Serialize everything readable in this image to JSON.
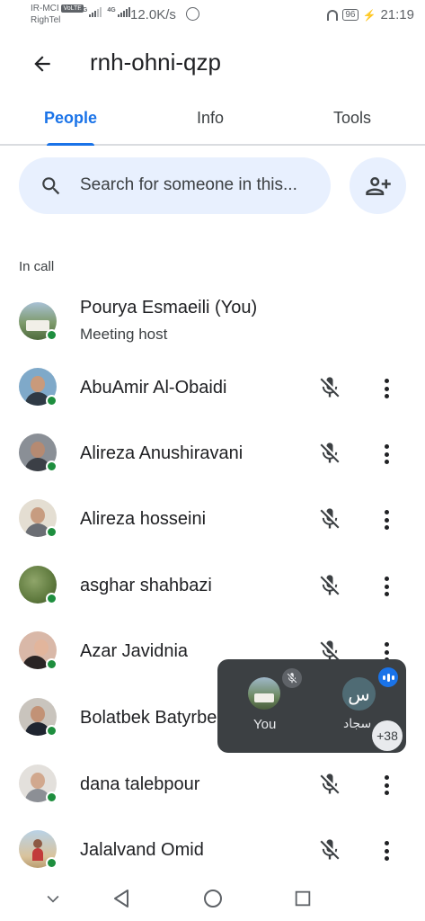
{
  "status_bar": {
    "carrier_1": "IR-MCI",
    "volte": "VoLTE",
    "carrier_2": "RighTel",
    "network_1": "4G",
    "network_2": "4G",
    "speed": "12.0K/s",
    "battery": "96",
    "time": "21:19"
  },
  "header": {
    "title": "rnh-ohni-qzp",
    "back_icon": "arrow-back-icon"
  },
  "tabs": [
    {
      "label": "People",
      "active": true
    },
    {
      "label": "Info",
      "active": false
    },
    {
      "label": "Tools",
      "active": false
    }
  ],
  "search": {
    "placeholder": "Search for someone in this...",
    "icon": "search-icon",
    "add_icon": "person-add-icon"
  },
  "section_label": "In call",
  "participants": [
    {
      "name": "Pourya Esmaeili (You)",
      "subtitle": "Meeting host",
      "muted": false,
      "online": true
    },
    {
      "name": "AbuAmir Al-Obaidi",
      "muted": true,
      "online": true
    },
    {
      "name": "Alireza Anushiravani",
      "muted": true,
      "online": true
    },
    {
      "name": "Alireza hosseini",
      "muted": true,
      "online": true
    },
    {
      "name": "asghar shahbazi",
      "muted": true,
      "online": true
    },
    {
      "name": "Azar Javidnia",
      "muted": true,
      "online": true
    },
    {
      "name": "Bolatbek Batyrbekov",
      "muted": true,
      "online": true
    },
    {
      "name": "dana talebpour",
      "muted": true,
      "online": true
    },
    {
      "name": "Jalalvand Omid",
      "muted": true,
      "online": true
    }
  ],
  "pip": {
    "you_label": "You",
    "other_initial": "س",
    "other_label": "سجاد",
    "more_count": "+38"
  },
  "colors": {
    "accent": "#1a73e8",
    "online": "#1e8e3e",
    "search_bg": "#e8f0fe",
    "pip_bg": "#3c4043"
  }
}
